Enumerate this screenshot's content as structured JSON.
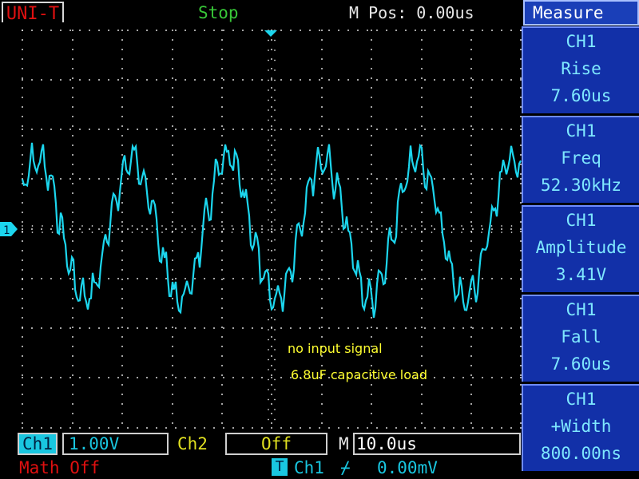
{
  "header": {
    "brand": "UNI-T",
    "status": "Stop",
    "mpos": "M Pos: 0.00us"
  },
  "menu": {
    "title": "Measure",
    "items": [
      {
        "channel": "CH1",
        "name": "Rise",
        "value": "7.60us"
      },
      {
        "channel": "CH1",
        "name": "Freq",
        "value": "52.30kHz"
      },
      {
        "channel": "CH1",
        "name": "Amplitude",
        "value": "3.41V"
      },
      {
        "channel": "CH1",
        "name": "Fall",
        "value": "7.60us"
      },
      {
        "channel": "CH1",
        "name": "+Width",
        "value": "800.00ns"
      }
    ]
  },
  "screen": {
    "channel_marker": "1",
    "annotations": [
      "no input signal",
      "6.8uF capacitive load"
    ]
  },
  "bottom": {
    "ch1_label": "Ch1",
    "ch1_scale": "1.00V",
    "ch2_label": "Ch2",
    "ch2_scale": "Off",
    "m_label": "M",
    "timebase": "10.0us",
    "math": "Math Off",
    "trigger_icon": "T",
    "trigger_source": "Ch1",
    "trigger_edge": "⌿",
    "trigger_level": "0.00mV"
  },
  "colors": {
    "grid": "#ffffff",
    "trace": "#1cd6ee",
    "brand_red": "#e01010",
    "menu_blue": "#1230a8"
  }
}
